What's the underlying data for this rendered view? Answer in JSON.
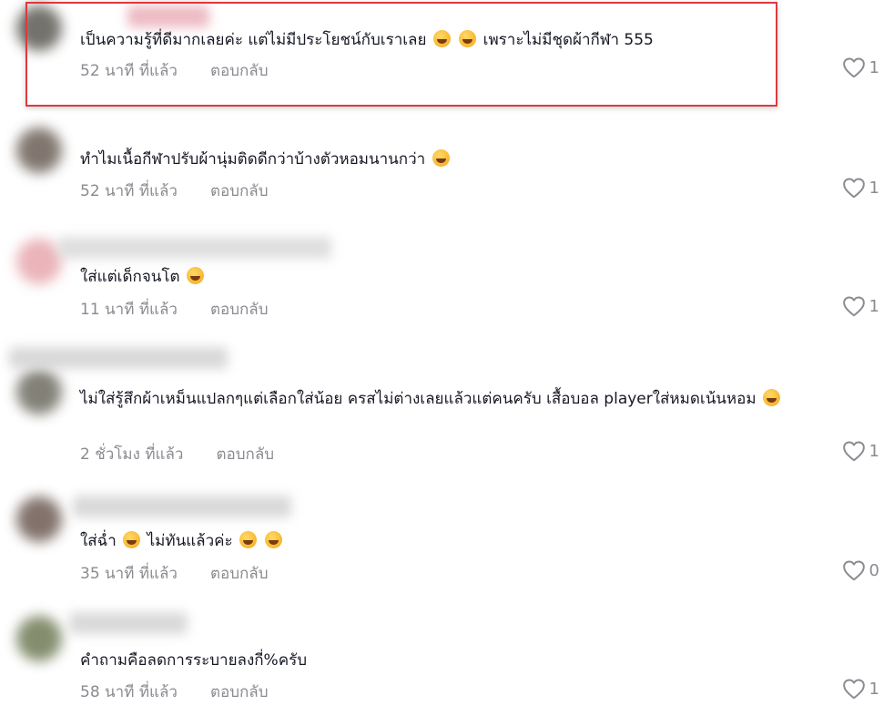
{
  "comments": [
    {
      "text": "เป็นความรู้ที่ดีมากเลยค่ะ แต่ไม่มีประโยชน์กับเราเลย",
      "emojis": [
        "laughing-emoji",
        "laughing-emoji"
      ],
      "text_after": "เพราะไม่มีชุดผ้ากีฬา 555",
      "time": "52 นาที ที่แล้ว",
      "reply": "ตอบกลับ",
      "likes": "1"
    },
    {
      "text": "ทำไมเนื้อกีฬาปรับผ้านุ่มติดดีกว่าบ้างตัวหอมนานกว่า",
      "emojis": [
        "rofl-emoji"
      ],
      "text_after": "",
      "time": "52 นาที ที่แล้ว",
      "reply": "ตอบกลับ",
      "likes": "1"
    },
    {
      "text": "ใส่แต่เด็กจนโต",
      "emojis": [
        "laughing-emoji"
      ],
      "text_after": "",
      "time": "11 นาที ที่แล้ว",
      "reply": "ตอบกลับ",
      "likes": "1"
    },
    {
      "text": "ไม่ใส่รู้สึกผ้าเหม็นแปลกๆแต่เลือกใส่น้อย ครสไม่ต่างเลยแล้วแต่คนครับ เสื้อบอล playerใส่หมดเน้นหอม",
      "emojis": [
        "rofl-emoji"
      ],
      "text_after": "",
      "time": "2 ชั่วโมง ที่แล้ว",
      "reply": "ตอบกลับ",
      "likes": "1"
    },
    {
      "text": "ใส่ฉ่ำ",
      "emojis": [
        "sweat-smile-emoji"
      ],
      "text_after": "ไม่ทันแล้วค่ะ",
      "emojis_after": [
        "grinning-squint-emoji",
        "hand-over-mouth-emoji"
      ],
      "time": "35 นาที ที่แล้ว",
      "reply": "ตอบกลับ",
      "likes": "0"
    },
    {
      "text": "คำถามคือลดการระบายลงกี่%ครับ",
      "emojis": [],
      "text_after": "",
      "time": "58 นาที ที่แล้ว",
      "reply": "ตอบกลับ",
      "likes": "1"
    }
  ],
  "colors": {
    "highlight_border": "#e0383e",
    "meta_text": "#8a8b91",
    "body_text": "#161823"
  },
  "icons": {
    "like": "heart-outline-icon"
  }
}
